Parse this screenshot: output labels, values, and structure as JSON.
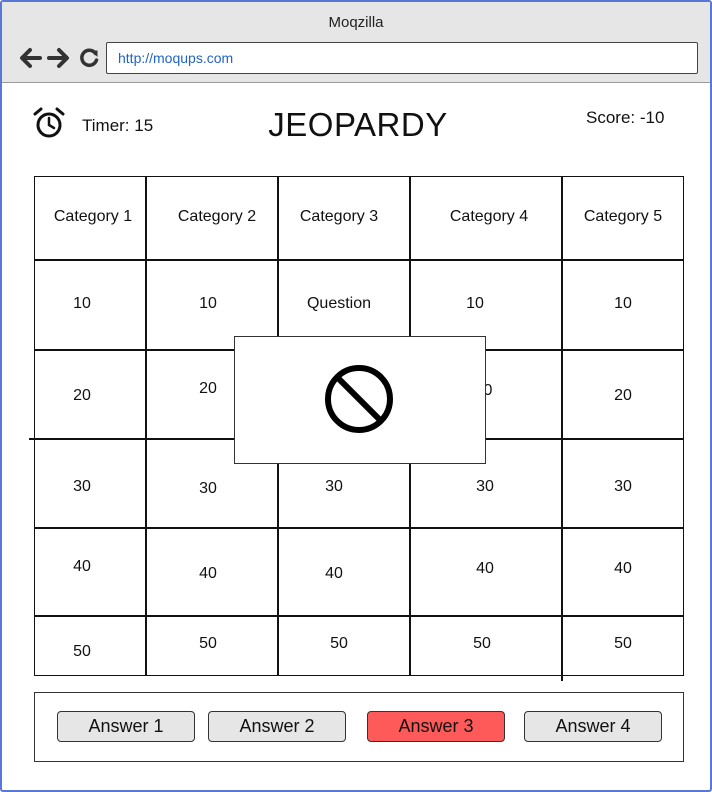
{
  "browser": {
    "title": "Moqzilla",
    "url": "http://moqups.com"
  },
  "icons": {
    "back": "arrow-left-icon",
    "forward": "arrow-right-icon",
    "reload": "reload-icon",
    "timer": "alarm-clock-icon",
    "blocked": "prohibited-icon"
  },
  "header": {
    "timer_label": "Timer: 15",
    "title": "JEOPARDY",
    "score_label": "Score: -10"
  },
  "board": {
    "categories": [
      "Category 1",
      "Category 2",
      "Category 3",
      "Category 4",
      "Category 5"
    ],
    "rows": [
      [
        "10",
        "10",
        "Question",
        "10",
        "10"
      ],
      [
        "20",
        "20",
        "",
        "0",
        "20"
      ],
      [
        "30",
        "30",
        "30",
        "30",
        "30"
      ],
      [
        "40",
        "40",
        "40",
        "40",
        "40"
      ],
      [
        "50",
        "50",
        "50",
        "50",
        "50"
      ]
    ]
  },
  "answers": {
    "items": [
      "Answer 1",
      "Answer 2",
      "Answer 3",
      "Answer 4"
    ],
    "selected_color": "#ff5a5a",
    "default_color": "#e6e6e6"
  }
}
